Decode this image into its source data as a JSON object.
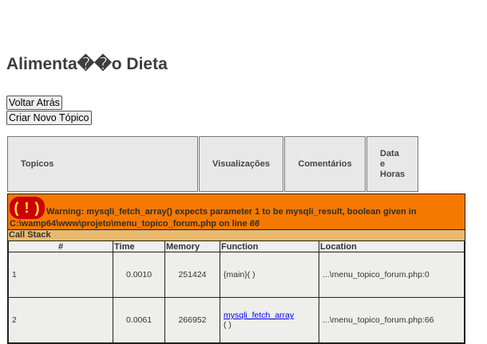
{
  "page": {
    "title": "Alimenta��o Dieta",
    "buttons": {
      "back": "Voltar Atrás",
      "new_topic": "Criar Novo Tópico"
    }
  },
  "topics_table": {
    "headers": [
      "Topicos",
      "Visualizações",
      "Comentários",
      "Data e Horas"
    ]
  },
  "error": {
    "icon": "( ! )",
    "message": "Warning: mysqli_fetch_array() expects parameter 1 to be mysqli_result, boolean given in",
    "file": "C:\\wamp64\\www\\projeto\\menu_topico_forum.php on line",
    "line": "66",
    "section_label": "Call Stack",
    "columns": [
      "#",
      "Time",
      "Memory",
      "Function",
      "Location"
    ],
    "rows": [
      {
        "index": "1",
        "time": "0.0010",
        "memory": "251424",
        "function": "{main}( )",
        "location": "...\\menu_topico_forum.php:0"
      },
      {
        "index": "2",
        "time": "0.0061",
        "memory": "266952",
        "function": "mysqli_fetch_array",
        "function_suffix": "( )",
        "location": "...\\menu_topico_forum.php:66"
      }
    ]
  },
  "colors": {
    "warning_bg": "#f57900",
    "icon_bg": "#cc0000",
    "callstack_bg": "#e9b96e",
    "row_bg": "#eeeeec"
  }
}
